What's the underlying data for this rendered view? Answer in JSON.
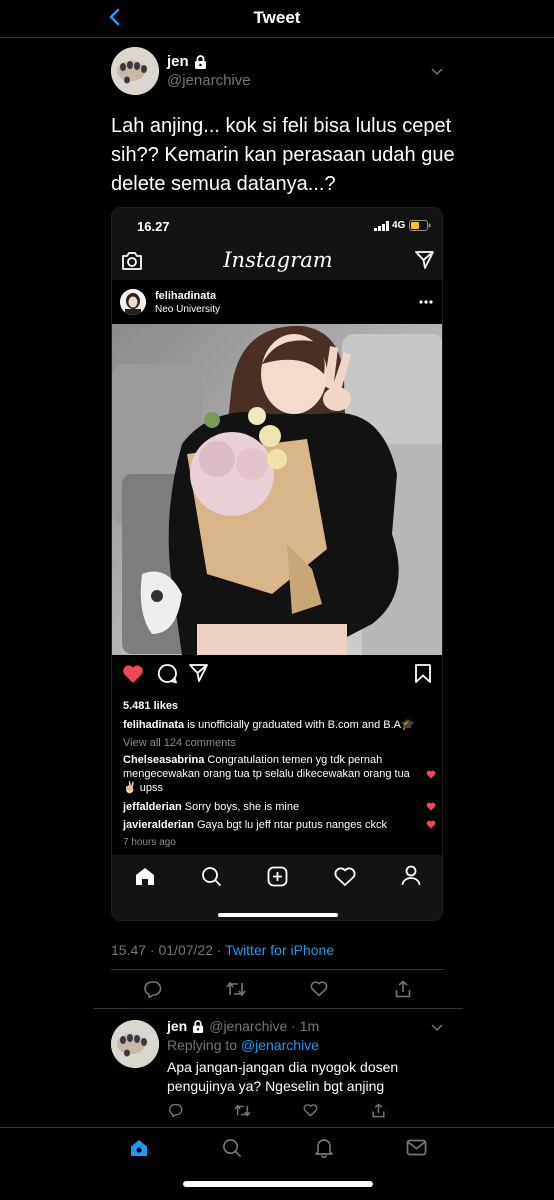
{
  "header": {
    "title": "Tweet"
  },
  "tweet": {
    "name": "jen",
    "handle": "@jenarchive",
    "text": "Lah anjing... kok si feli bisa lulus cepet sih?? Kemarin kan perasaan udah gue delete semua datanya...?",
    "time": "15.47 · 01/07/22 · ",
    "source": "Twitter for iPhone"
  },
  "embedded": {
    "status_time": "16.27",
    "network": "4G",
    "app_name": "Instagram",
    "post": {
      "username": "felihadinata",
      "location": "Neo University",
      "likes": "5.481 likes",
      "caption_user": "felihadinata",
      "caption_text": " is unofficially graduated with B.com and B.A🎓",
      "view_comments": "View all 124 comments",
      "comments": [
        {
          "user": "Chelseasabrina",
          "text": " Congratulation temen yg tdk pernah mengecewakan orang tua tp selalu dikecewakan orang tua✌🏻 upss"
        },
        {
          "user": "jeffalderian",
          "text": " Sorry boys, she is mine"
        },
        {
          "user": "javieralderian",
          "text": " Gaya bgt lu jeff ntar putus nanges ckck"
        }
      ],
      "time_ago": "7 hours ago"
    }
  },
  "reply": {
    "name": "jen",
    "handle_time": "@jenarchive · 1m",
    "replying_prefix": "Replying to ",
    "replying_to": "@jenarchive",
    "text": "Apa jangan-jangan dia nyogok dosen pengujinya ya? Ngeselin bgt anjing"
  },
  "colors": {
    "accent": "#1d9bf0",
    "like_red": "#ed4956"
  }
}
